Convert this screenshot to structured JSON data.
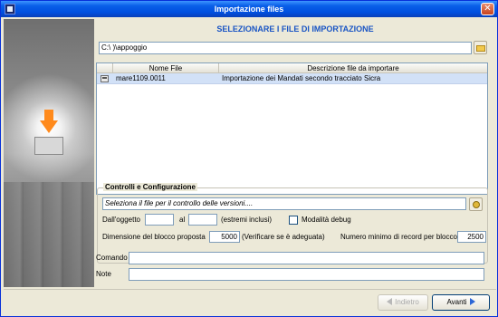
{
  "window": {
    "title": "Importazione files"
  },
  "header": {
    "title": "SELEZIONARE I FILE DI IMPORTAZIONE"
  },
  "path": {
    "value": "C:\\                              )\\appoggio"
  },
  "grid": {
    "columns": [
      "Nome File",
      "Descrizione file da importare"
    ],
    "rows": [
      {
        "name": "mare1109.0011",
        "description": "Importazione dei Mandati secondo tracciato Sicra"
      }
    ]
  },
  "controls": {
    "title": "Controlli e Configurazione",
    "select_placeholder": "Seleziona il file per il controllo delle versioni....",
    "from_label": "Dall'oggetto",
    "to_label": "al",
    "extremes_label": "(estremi inclusi)",
    "debug_label": "Modalità debug",
    "block_size_label": "Dimensione del blocco proposta",
    "block_size_value": "5000",
    "block_hint": "(Verificare se è adeguata)",
    "min_records_label": "Numero minimo di record per blocco",
    "min_records_value": "2500"
  },
  "command": {
    "label": "Comando"
  },
  "note": {
    "label": "Note"
  },
  "footer": {
    "back_label": "Indietro",
    "next_label": "Avanti"
  }
}
